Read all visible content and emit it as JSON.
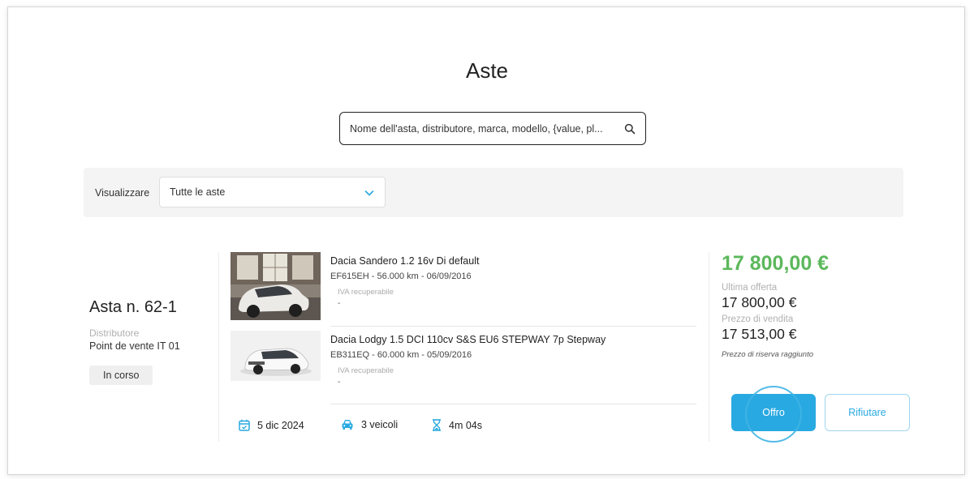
{
  "page": {
    "title": "Aste"
  },
  "search": {
    "placeholder": "Nome dell'asta, distributore, marca, modello, {value, pl..."
  },
  "filter": {
    "label": "Visualizzare",
    "selected": "Tutte le aste"
  },
  "auction": {
    "name": "Asta n. 62-1",
    "distributor_label": "Distributore",
    "distributor": "Point de vente IT 01",
    "status": "In corso",
    "vehicles": [
      {
        "title": "Dacia Sandero 1.2 16v Di default",
        "subtitle": "EF615EH - 56.000 km - 06/09/2016",
        "vat_label": "IVA recuperabile",
        "vat_value": "-"
      },
      {
        "title": "Dacia Lodgy 1.5 DCI 110cv S&S EU6 STEPWAY 7p Stepway",
        "subtitle": "EB311EQ - 60.000 km - 05/09/2016",
        "vat_label": "IVA recuperabile",
        "vat_value": "-"
      }
    ],
    "date": "5 dic 2024",
    "vehicle_count": "3 veicoli",
    "time_left": "4m 04s"
  },
  "pricing": {
    "current_offer": "17 800,00 €",
    "last_offer_label": "Ultima offerta",
    "last_offer": "17 800,00 €",
    "sale_price_label": "Prezzo di vendita",
    "sale_price": "17 513,00 €",
    "reserve_note": "Prezzo di riserva raggiunto"
  },
  "actions": {
    "offer_label": "Offro",
    "refuse_label": "Rifiutare"
  },
  "colors": {
    "accent": "#29a9e1",
    "price_green": "#5cb85c",
    "muted": "#b0b0b0"
  },
  "icons": [
    "search-icon",
    "chevron-down-icon",
    "calendar-icon",
    "car-icon",
    "hourglass-icon"
  ]
}
